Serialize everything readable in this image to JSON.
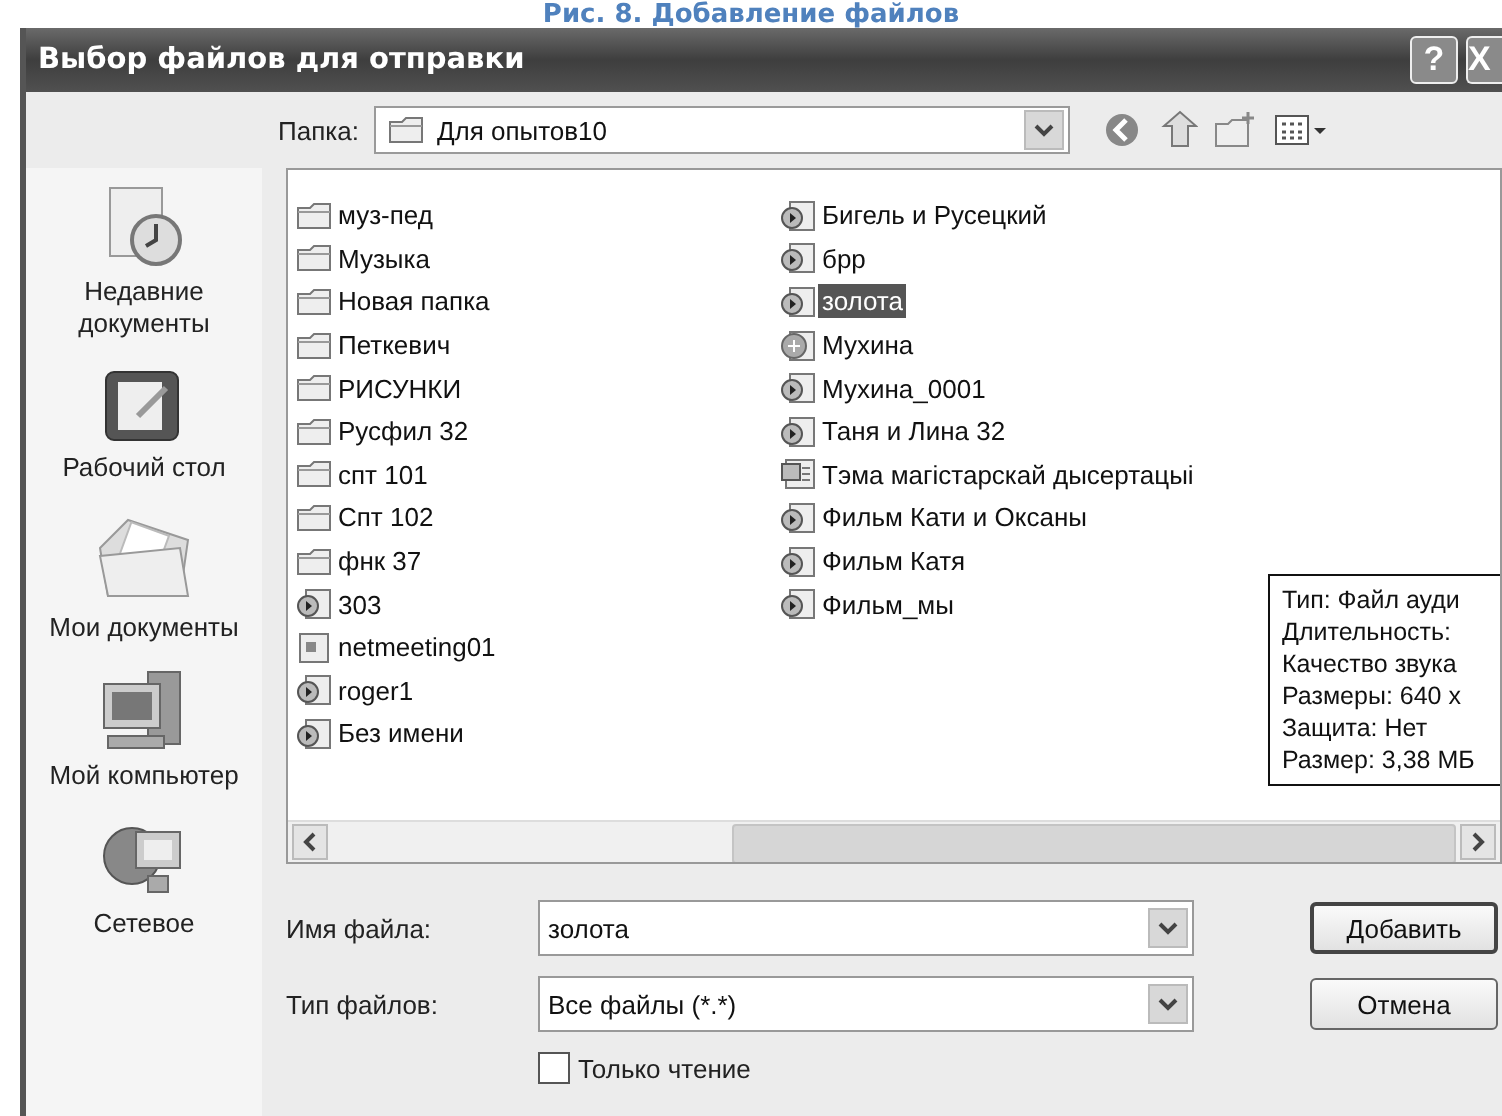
{
  "caption": "Рис. 8. Добавление файлов",
  "window": {
    "title": "Выбор файлов для отправки",
    "buttons": [
      "?",
      "X"
    ]
  },
  "folder": {
    "label": "Папка:",
    "value": "Для опытов10"
  },
  "places": [
    {
      "label": "Недавние документы",
      "kind": "recent"
    },
    {
      "label": "Рабочий стол",
      "kind": "desktop"
    },
    {
      "label": "Мои документы",
      "kind": "documents"
    },
    {
      "label": "Мой компьютер",
      "kind": "computer"
    },
    {
      "label": "Сетевое",
      "kind": "network"
    }
  ],
  "files": [
    [
      {
        "name": "муз-пед",
        "kind": "folder",
        "selected": false
      },
      {
        "name": "Музыка",
        "kind": "folder",
        "selected": false
      },
      {
        "name": "Новая папка",
        "kind": "folder",
        "selected": false
      },
      {
        "name": "Петкевич",
        "kind": "folder",
        "selected": false
      },
      {
        "name": "РИСУНКИ",
        "kind": "folder",
        "selected": false
      },
      {
        "name": "Русфил 32",
        "kind": "folder",
        "selected": false
      },
      {
        "name": "спт 101",
        "kind": "folder",
        "selected": false
      },
      {
        "name": "Спт 102",
        "kind": "folder",
        "selected": false
      },
      {
        "name": "фнк 37",
        "kind": "folder",
        "selected": false
      },
      {
        "name": "303",
        "kind": "video",
        "selected": false
      },
      {
        "name": "netmeeting01",
        "kind": "file",
        "selected": false
      },
      {
        "name": "roger1",
        "kind": "video",
        "selected": false
      },
      {
        "name": "Без имени",
        "kind": "video",
        "selected": false
      }
    ],
    [
      {
        "name": "Бигель и Русецкий",
        "kind": "video",
        "selected": false
      },
      {
        "name": "брр",
        "kind": "video",
        "selected": false
      },
      {
        "name": "золота",
        "kind": "video",
        "selected": true
      },
      {
        "name": "Мухина",
        "kind": "media",
        "selected": false
      },
      {
        "name": "Мухина_0001",
        "kind": "video",
        "selected": false
      },
      {
        "name": "Таня и Лина 32",
        "kind": "video",
        "selected": false
      },
      {
        "name": "Тэма магістарскай дысертацыі",
        "kind": "doc",
        "selected": false
      },
      {
        "name": "Фильм Кати и Оксаны",
        "kind": "video",
        "selected": false
      },
      {
        "name": "Фильм Катя",
        "kind": "video",
        "selected": false
      },
      {
        "name": "Фильм_мы",
        "kind": "video",
        "selected": false
      }
    ]
  ],
  "tooltip": [
    "Тип: Файл ауди",
    "Длительность:",
    "Качество звука",
    "Размеры: 640 x",
    "Защита: Нет",
    "Размер: 3,38 МБ"
  ],
  "filename": {
    "label": "Имя файла:",
    "value": "золота"
  },
  "filetype": {
    "label": "Тип файлов:",
    "value": "Все файлы (*.*)"
  },
  "readonly": {
    "label": "Только чтение",
    "checked": false
  },
  "actions": [
    {
      "label": "Добавить",
      "default": true
    },
    {
      "label": "Отмена",
      "default": false
    }
  ]
}
